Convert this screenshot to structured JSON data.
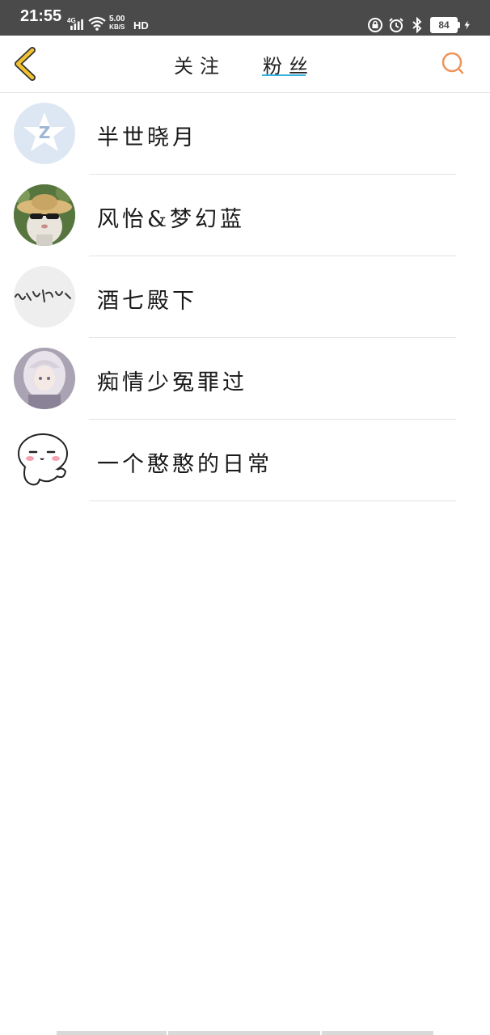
{
  "status_bar": {
    "time": "21:55",
    "network": "4G",
    "speed_value": "5.00",
    "speed_unit": "KB/S",
    "hd_label": "HD",
    "battery": "84"
  },
  "nav": {
    "tabs": [
      {
        "label": "关注",
        "active": false
      },
      {
        "label": "粉丝",
        "active": true
      }
    ],
    "accent_color": "#35b2e0",
    "back_icon_color": "#f2c230",
    "search_icon_color": "#f0935a"
  },
  "users": [
    {
      "name": "半世晓月",
      "avatar": "qq-default-avatar"
    },
    {
      "name": "风怡&梦幻蓝",
      "avatar": "cat-sunglasses-avatar"
    },
    {
      "name": "酒七殿下",
      "avatar": "calligraphy-avatar"
    },
    {
      "name": "痴情少冤罪过",
      "avatar": "anime-girl-avatar"
    },
    {
      "name": "一个憨憨的日常",
      "avatar": "blob-sticker-avatar"
    }
  ]
}
